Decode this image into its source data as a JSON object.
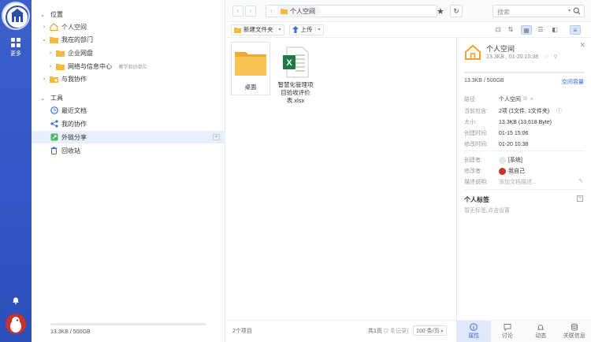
{
  "rail": {
    "more_label": "更多"
  },
  "sidebar": {
    "location_title": "位置",
    "tools_title": "工具",
    "location_items": [
      {
        "label": "个人空间",
        "hint": ""
      },
      {
        "label": "我在的部门",
        "hint": ""
      },
      {
        "label": "企业网盘",
        "hint": ""
      },
      {
        "label": "网络与信息中心",
        "hint": "· 教学和协单位"
      },
      {
        "label": "与我协作",
        "hint": ""
      }
    ],
    "tool_items": [
      {
        "label": "最近文档"
      },
      {
        "label": "我的协作"
      },
      {
        "label": "外链分享"
      },
      {
        "label": "回收站"
      }
    ],
    "storage_text": "13.3KB / 500GB",
    "storage_fraction": 0.0
  },
  "topbar": {
    "breadcrumb": "个人空间",
    "search_placeholder": "搜索"
  },
  "toolbar": {
    "new_folder_label": "新建文件夹",
    "upload_label": "上传"
  },
  "files": [
    {
      "name": "桌面",
      "type": "folder"
    },
    {
      "name": "智慧化管理项目验收评价表.xlsx",
      "type": "xlsx"
    }
  ],
  "footer": {
    "item_count": "2个项目",
    "page_info": "共1页",
    "record_info": "(2 条记录)",
    "per_page": "100 条/页"
  },
  "panel": {
    "title": "个人空间",
    "subtitle": "13.3KB , 01-20 10:38",
    "quota_text": "13.3KB / 500GB",
    "quota_link": "空间容量",
    "props": [
      {
        "key": "路径:",
        "value": "个人空间"
      },
      {
        "key": "当前包含:",
        "value": "2项 (1文件, 1文件夹)"
      },
      {
        "key": "大小:",
        "value": "13.3KB (13,618 Byte)"
      },
      {
        "key": "创建时间:",
        "value": "01-15 15:06"
      },
      {
        "key": "修改时间:",
        "value": "01-20 10:38"
      }
    ],
    "people": [
      {
        "key": "创建者:",
        "value": "[系统]"
      },
      {
        "key": "修改者:",
        "value": "我自己"
      },
      {
        "key": "描述说明:",
        "value": "添加文档描述..."
      }
    ],
    "tags_title": "个人标签",
    "tags_hint": "暂无标签,点击设置",
    "tabs": [
      "属性",
      "讨论",
      "动态",
      "关联信息"
    ]
  },
  "colors": {
    "rail": "#3456c7",
    "accent": "#3a6fd8",
    "folder": "#f5b942",
    "excel": "#1f7a45"
  }
}
